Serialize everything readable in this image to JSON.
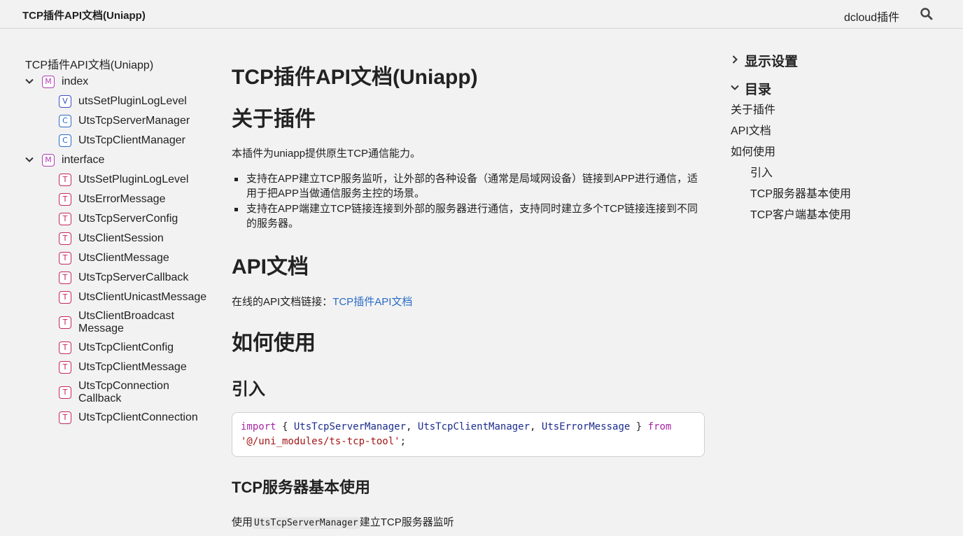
{
  "header": {
    "title": "TCP插件API文档(Uniapp)",
    "link": "dcloud插件",
    "search_icon": "search-icon"
  },
  "nav": {
    "root": "TCP插件API文档(Uniapp)",
    "modules": [
      {
        "badge": "M",
        "label": "index",
        "items": [
          {
            "badge": "V",
            "label": "utsSetPluginLogLevel"
          },
          {
            "badge": "C",
            "label": "UtsTcpServerManager"
          },
          {
            "badge": "C",
            "label": "UtsTcpClientManager"
          }
        ]
      },
      {
        "badge": "M",
        "label": "interface",
        "items": [
          {
            "badge": "T",
            "label": "UtsSetPluginLogLevel"
          },
          {
            "badge": "T",
            "label": "UtsErrorMessage"
          },
          {
            "badge": "T",
            "label": "UtsTcpServerConfig"
          },
          {
            "badge": "T",
            "label": "UtsClientSession"
          },
          {
            "badge": "T",
            "label": "UtsClientMessage"
          },
          {
            "badge": "T",
            "label": "UtsTcpServerCallback"
          },
          {
            "badge": "T",
            "label": "UtsClientUnicastMessage"
          },
          {
            "badge": "T",
            "label": "UtsClientBroadcast Message"
          },
          {
            "badge": "T",
            "label": "UtsTcpClientConfig"
          },
          {
            "badge": "T",
            "label": "UtsTcpClientMessage"
          },
          {
            "badge": "T",
            "label": "UtsTcpConnection Callback"
          },
          {
            "badge": "T",
            "label": "UtsTcpClientConnection"
          }
        ]
      }
    ]
  },
  "main": {
    "title": "TCP插件API文档(Uniapp)",
    "about_heading": "关于插件",
    "about_text": "本插件为uniapp提供原生TCP通信能力。",
    "bullets": [
      "支持在APP建立TCP服务监听，让外部的各种设备（通常是局域网设备）链接到APP进行通信，适用于把APP当做通信服务主控的场景。",
      "支持在APP端建立TCP链接连接到外部的服务器进行通信，支持同时建立多个TCP链接连接到不同的服务器。"
    ],
    "api_heading": "API文档",
    "api_text": "在线的API文档链接：",
    "api_link": "TCP插件API文档",
    "usage_heading": "如何使用",
    "import_heading": "引入",
    "code": {
      "import_kw": "import",
      "open": " { ",
      "name1": "UtsTcpServerManager",
      "sep1": ", ",
      "name2": "UtsTcpClientManager",
      "sep2": ", ",
      "name3": "UtsErrorMessage",
      "close": " } ",
      "from_kw": "from",
      "module": "'@/uni_modules/ts-tcp-tool'",
      "end": ";"
    },
    "server_heading": "TCP服务器基本使用",
    "server_text_pre": "使用",
    "server_text_code": "UtsTcpServerManager",
    "server_text_post": "建立TCP服务器监听"
  },
  "toc": {
    "display_settings": "显示设置",
    "contents": "目录",
    "items": [
      {
        "label": "关于插件",
        "level": 1
      },
      {
        "label": "API文档",
        "level": 1
      },
      {
        "label": "如何使用",
        "level": 1
      },
      {
        "label": "引入",
        "level": 2
      },
      {
        "label": "TCP服务器基本使用",
        "level": 2
      },
      {
        "label": "TCP客户端基本使用",
        "level": 2
      }
    ]
  }
}
